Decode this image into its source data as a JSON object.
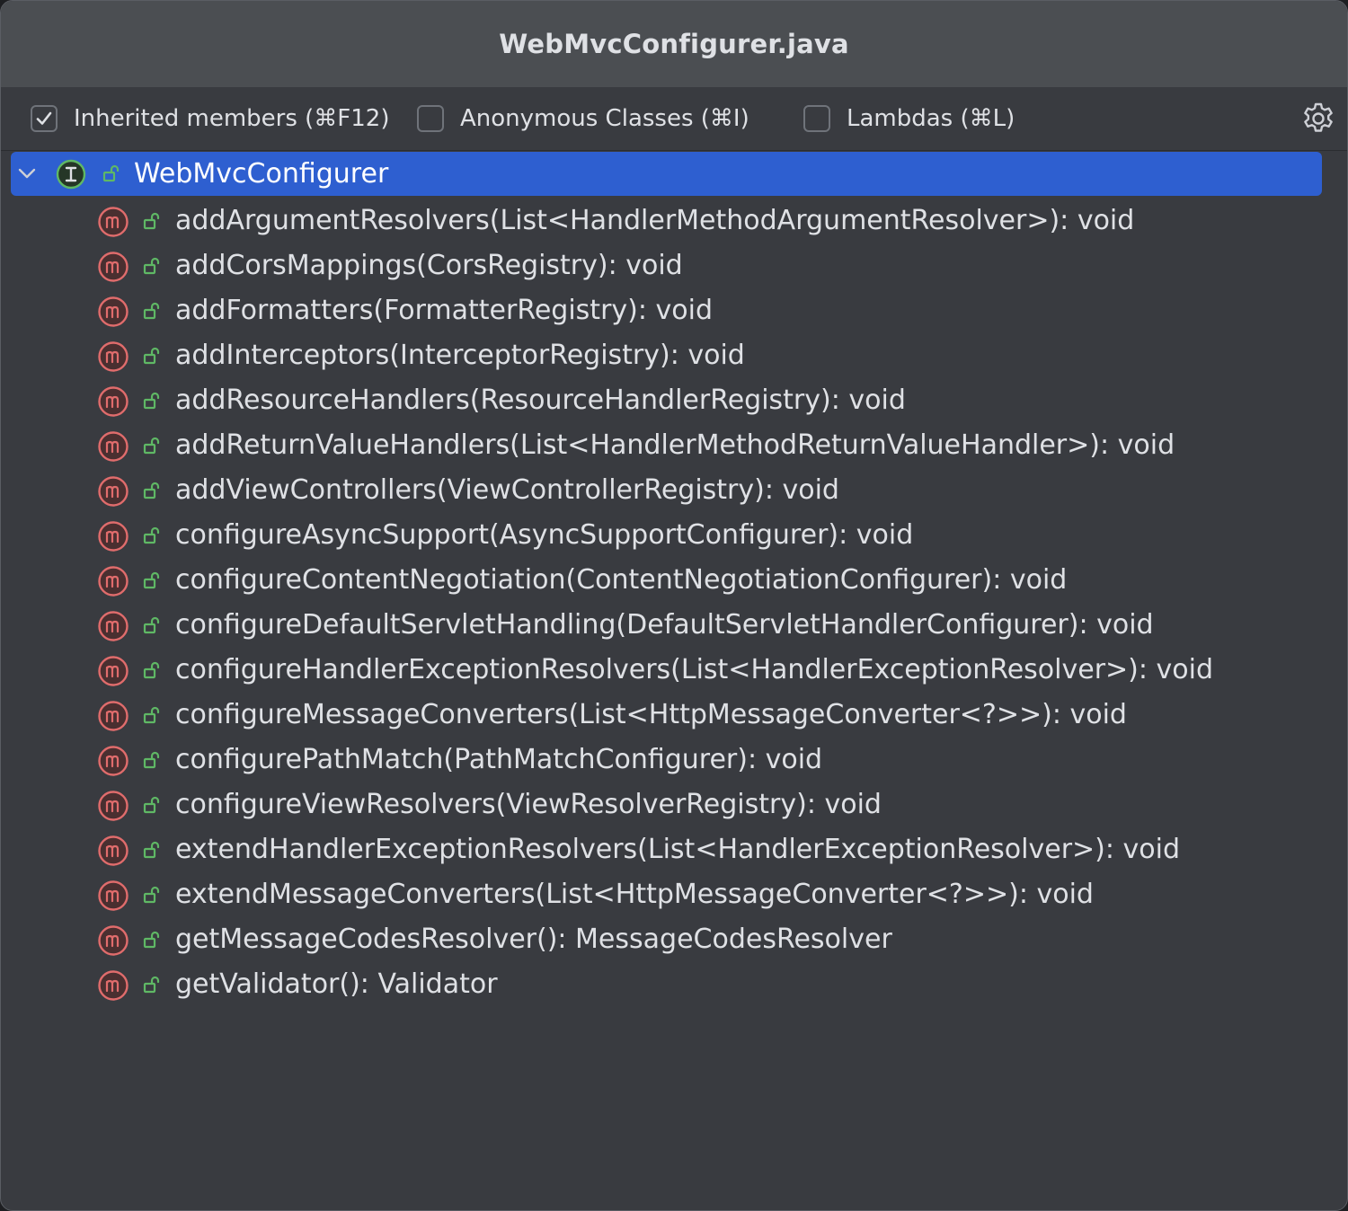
{
  "window": {
    "title": "WebMvcConfigurer.java"
  },
  "toolbar": {
    "inherited_members": {
      "label": "Inherited members (⌘F12)",
      "checked": true
    },
    "anonymous_classes": {
      "label": "Anonymous Classes (⌘I)",
      "checked": false
    },
    "lambdas": {
      "label": "Lambdas (⌘L)",
      "checked": false
    },
    "settings_icon": "gear-icon"
  },
  "tree": {
    "root": {
      "label": "WebMvcConfigurer",
      "icon": "interface-icon",
      "visibility_icon": "public-lock-icon",
      "expanded": true,
      "selected": true
    },
    "members": [
      {
        "label": "addArgumentResolvers(List<HandlerMethodArgumentResolver>): void"
      },
      {
        "label": "addCorsMappings(CorsRegistry): void"
      },
      {
        "label": "addFormatters(FormatterRegistry): void"
      },
      {
        "label": "addInterceptors(InterceptorRegistry): void"
      },
      {
        "label": "addResourceHandlers(ResourceHandlerRegistry): void"
      },
      {
        "label": "addReturnValueHandlers(List<HandlerMethodReturnValueHandler>): void"
      },
      {
        "label": "addViewControllers(ViewControllerRegistry): void"
      },
      {
        "label": "configureAsyncSupport(AsyncSupportConfigurer): void"
      },
      {
        "label": "configureContentNegotiation(ContentNegotiationConfigurer): void"
      },
      {
        "label": "configureDefaultServletHandling(DefaultServletHandlerConfigurer): void"
      },
      {
        "label": "configureHandlerExceptionResolvers(List<HandlerExceptionResolver>): void"
      },
      {
        "label": "configureMessageConverters(List<HttpMessageConverter<?>>): void"
      },
      {
        "label": "configurePathMatch(PathMatchConfigurer): void"
      },
      {
        "label": "configureViewResolvers(ViewResolverRegistry): void"
      },
      {
        "label": "extendHandlerExceptionResolvers(List<HandlerExceptionResolver>): void"
      },
      {
        "label": "extendMessageConverters(List<HttpMessageConverter<?>>): void"
      },
      {
        "label": "getMessageCodesResolver(): MessageCodesResolver"
      },
      {
        "label": "getValidator(): Validator"
      }
    ]
  },
  "colors": {
    "background": "#393b40",
    "titlebar": "#4b4e52",
    "selection": "#2e5fd0",
    "method_icon": "#e06c6c",
    "lock_icon": "#5fb865",
    "interface_icon": "#5fb865",
    "text": "#dfe1e5"
  }
}
